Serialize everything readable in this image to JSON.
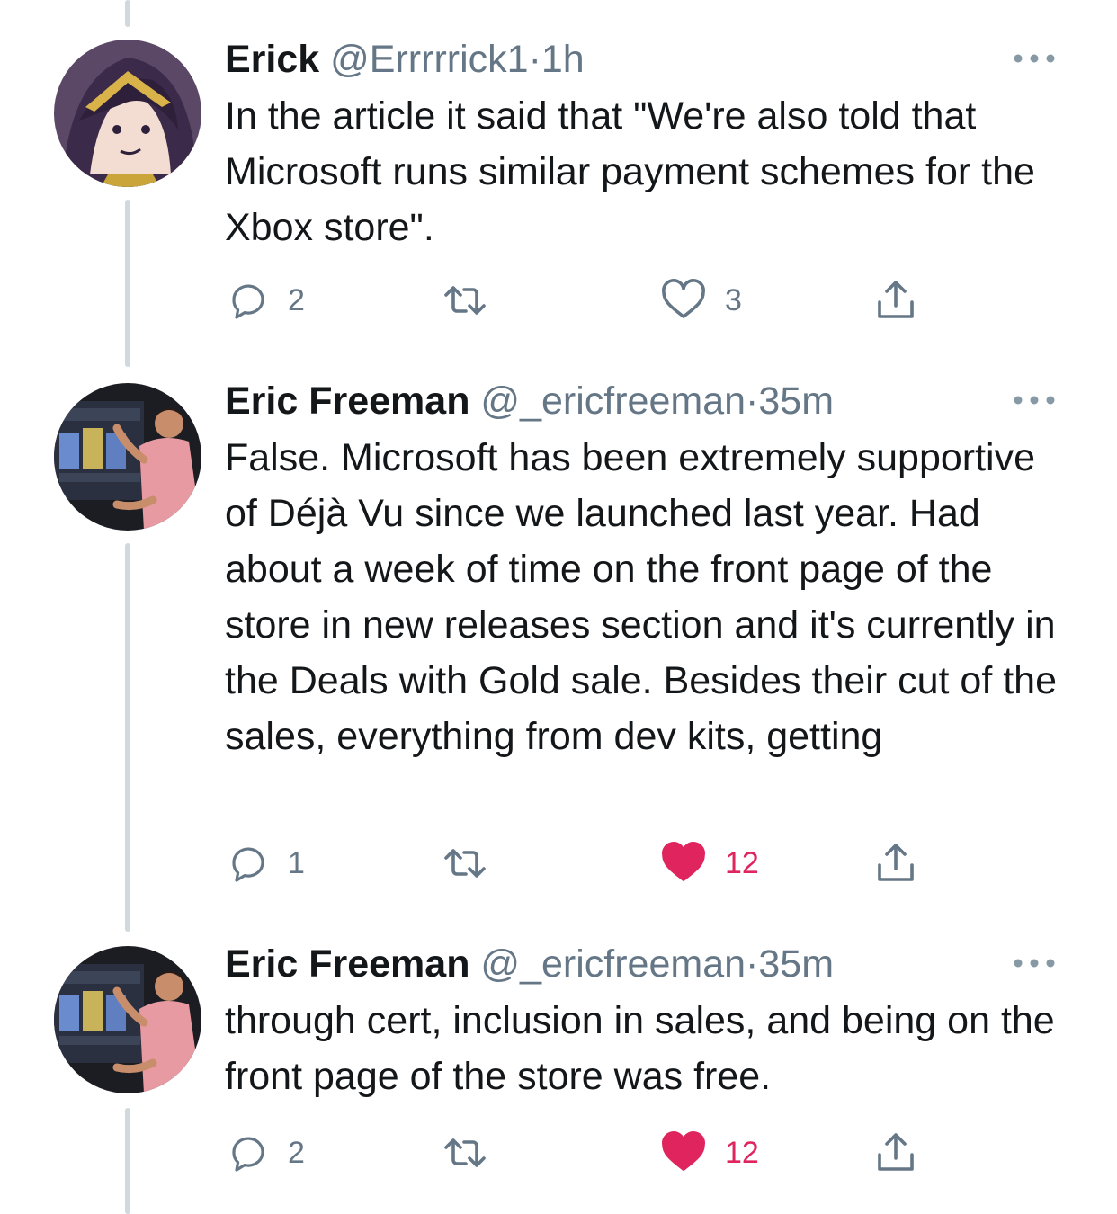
{
  "colors": {
    "text": "#14171a",
    "secondary": "#657786",
    "thread_line": "#cfd9de",
    "like_active": "#e0245e"
  },
  "tweets": [
    {
      "name": "Erick",
      "handle": "@Errrrrick1",
      "separator": "·",
      "time": "1h",
      "text": "In the article it said that \"We're also told that Microsoft runs similar payment schemes for the Xbox store\".",
      "replies": "2",
      "retweets": "",
      "likes": "3",
      "liked": false,
      "avatar": "anime-character-avatar"
    },
    {
      "name": "Eric Freeman",
      "handle": "@_ericfreeman",
      "separator": "·",
      "time": "35m",
      "text": "False. Microsoft has been extremely supportive of Déjà Vu since we launched last year. Had about a week of time on the front page of the store in new releases section and it's currently in the Deals with Gold sale. Besides their cut of the sales, everything from dev kits, getting",
      "replies": "1",
      "retweets": "",
      "likes": "12",
      "liked": true,
      "avatar": "photo-avatar"
    },
    {
      "name": "Eric Freeman",
      "handle": "@_ericfreeman",
      "separator": "·",
      "time": "35m",
      "text": "through cert, inclusion in sales, and being on the front page of the store was free.",
      "replies": "2",
      "retweets": "",
      "likes": "12",
      "liked": true,
      "avatar": "photo-avatar"
    }
  ]
}
